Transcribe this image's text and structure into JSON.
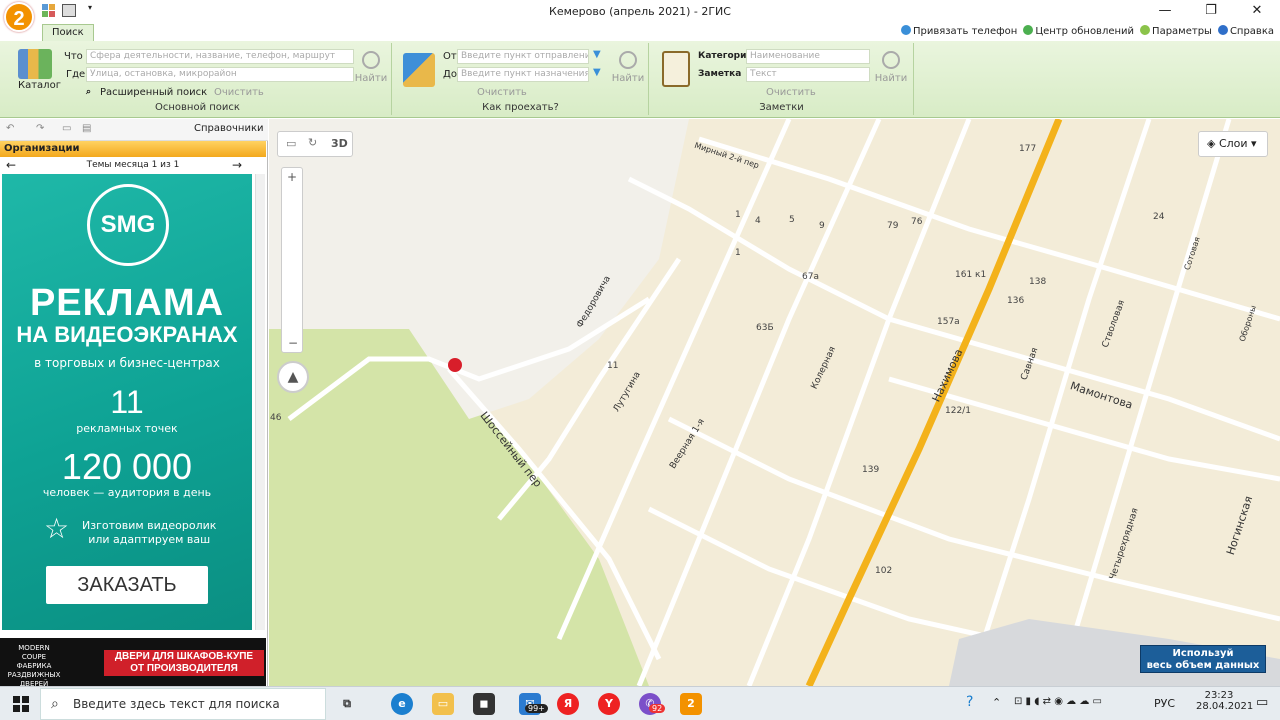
{
  "window": {
    "title": "Кемерово (апрель 2021) - 2ГИС",
    "logo": "2",
    "controls": [
      "—",
      "❐",
      "✕"
    ]
  },
  "ribbon_tab": "Поиск",
  "top_links": [
    "Привязать телефон",
    "Центр обновлений",
    "Параметры",
    "Справка"
  ],
  "search_group": {
    "catalog_label": "Каталог",
    "what_label": "Что",
    "what_placeholder": "Сфера деятельности, название, телефон, маршрут",
    "where_label": "Где",
    "where_placeholder": "Улица, остановка, микрорайон",
    "find_label": "Найти",
    "advanced_label": "Расширенный поиск",
    "clear_label": "Очистить",
    "title": "Основной поиск"
  },
  "route_group": {
    "from_label": "От",
    "from_placeholder": "Введите пункт отправления",
    "to_label": "До",
    "to_placeholder": "Введите пункт назначения",
    "clear_label": "Очистить",
    "find_label": "Найти",
    "title": "Как проехать?"
  },
  "notes_group": {
    "category_label": "Категория",
    "category_placeholder": "Наименование",
    "note_label": "Заметка",
    "note_placeholder": "Текст",
    "clear_label": "Очистить",
    "find_label": "Найти",
    "title": "Заметки"
  },
  "sidebar": {
    "directories_label": "Справочники",
    "organizations_label": "Организации",
    "themes_label": "Темы месяца 1 из 1",
    "ad": {
      "logo": "SMG",
      "headline1": "РЕКЛАМА",
      "headline2": "НА ВИДЕОЭКРАНАХ",
      "sub": "в торговых и бизнес-центрах",
      "num1": "11",
      "num1_label": "рекламных точек",
      "num2": "120 000",
      "num2_label": "человек — аудитория в день",
      "offer1": "Изготовим видеоролик",
      "offer2": "или адаптируем ваш",
      "button": "ЗАКАЗАТЬ"
    },
    "banner": {
      "brand": "MODERN COUPE",
      "brand_sub": "ФАБРИКА РАЗДВИЖНЫХ ДВЕРЕЙ",
      "headline": "ДВЕРИ ДЛЯ ШКАФОВ-КУПЕ",
      "sub": "ОТ ПРОИЗВОДИТЕЛЯ"
    }
  },
  "map": {
    "mode_3d": "3D",
    "layers_label": "Слои",
    "promo_line1": "Используй",
    "promo_line2": "весь объем данных",
    "streets": [
      "Нахимова",
      "Мамонтова",
      "Шоссейный пер",
      "Лутугина",
      "Федоровича",
      "Колерная",
      "Веерная 1-я",
      "Савная",
      "Стволовая",
      "Ногинская",
      "Четырехрядная",
      "Мирный 2-й пер",
      "Сотовая",
      "Обороны"
    ],
    "house_numbers": [
      "177",
      "79",
      "76",
      "24",
      "1",
      "4",
      "5",
      "9",
      "1",
      "67а",
      "161 к1",
      "138",
      "136",
      "63Б",
      "157а",
      "11",
      "122/1",
      "139",
      "102",
      "46"
    ]
  },
  "taskbar": {
    "search_placeholder": "Введите здесь текст для поиска",
    "badge_mail": "99+",
    "badge_viber": "92",
    "lang": "РУС",
    "time": "23:23",
    "date": "28.04.2021"
  }
}
